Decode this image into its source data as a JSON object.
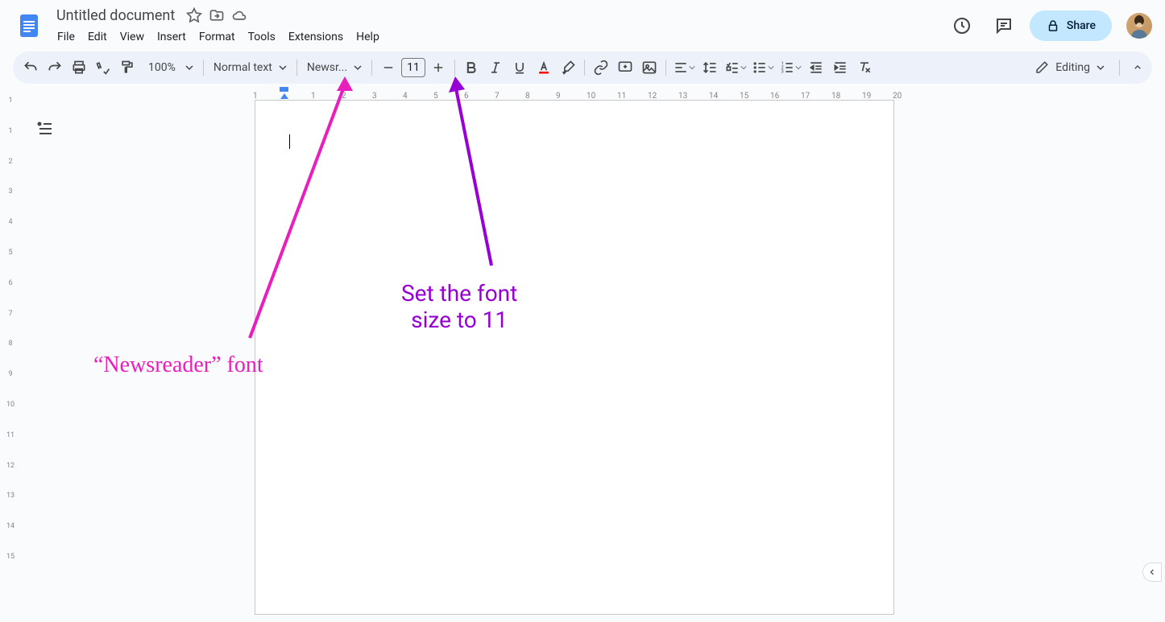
{
  "header": {
    "doc_title": "Untitled document",
    "menus": [
      "File",
      "Edit",
      "View",
      "Insert",
      "Format",
      "Tools",
      "Extensions",
      "Help"
    ],
    "share_label": "Share"
  },
  "toolbar": {
    "zoom": "100%",
    "style": "Normal text",
    "font": "Newsr...",
    "font_size": "11",
    "editing_label": "Editing"
  },
  "ruler": {
    "h_numbers": [
      "1",
      "1",
      "2",
      "3",
      "4",
      "5",
      "6",
      "7",
      "8",
      "9",
      "10",
      "11",
      "12",
      "13",
      "14",
      "15",
      "16",
      "17",
      "18",
      "19",
      "20"
    ],
    "v_numbers": [
      "1",
      "1",
      "2",
      "3",
      "4",
      "5",
      "6",
      "7",
      "8",
      "9",
      "10",
      "11",
      "12",
      "13",
      "14",
      "15"
    ]
  },
  "annotations": {
    "pink_text": "“Newsreader” font",
    "purple_text_l1": "Set the font",
    "purple_text_l2": "size to 11"
  }
}
